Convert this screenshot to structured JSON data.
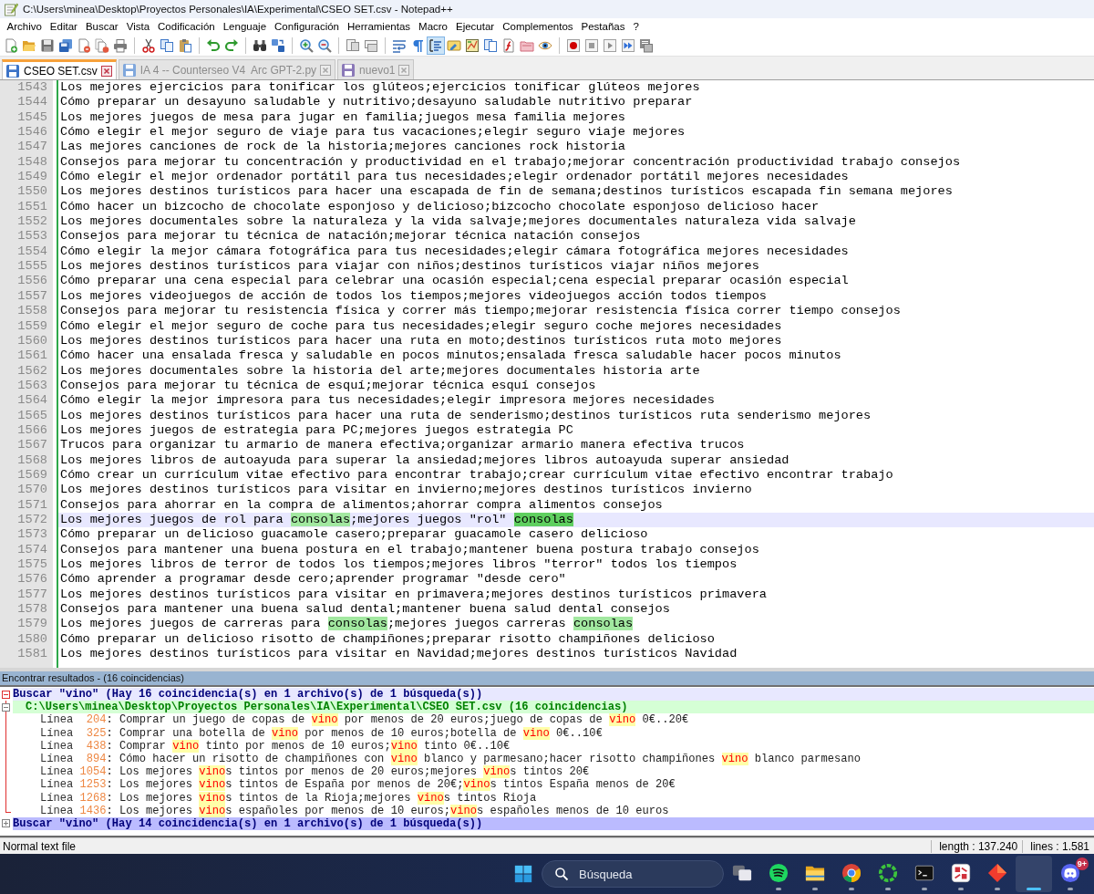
{
  "window": {
    "title": "C:\\Users\\minea\\Desktop\\Proyectos Personales\\IA\\Experimental\\CSEO SET.csv - Notepad++"
  },
  "menu": [
    "Archivo",
    "Editar",
    "Buscar",
    "Vista",
    "Codificación",
    "Lenguaje",
    "Configuración",
    "Herramientas",
    "Macro",
    "Ejecutar",
    "Complementos",
    "Pestañas",
    "?"
  ],
  "toolbar": [
    {
      "kind": "new",
      "pressed": false
    },
    {
      "kind": "open",
      "pressed": false
    },
    {
      "kind": "save",
      "pressed": false
    },
    {
      "kind": "save-all",
      "pressed": false
    },
    {
      "kind": "close",
      "pressed": false
    },
    {
      "kind": "close-all",
      "pressed": false
    },
    {
      "kind": "print",
      "pressed": false
    },
    {
      "kind": "separator"
    },
    {
      "kind": "cut",
      "pressed": false
    },
    {
      "kind": "copy",
      "pressed": false
    },
    {
      "kind": "paste",
      "pressed": false
    },
    {
      "kind": "separator"
    },
    {
      "kind": "undo",
      "pressed": false
    },
    {
      "kind": "redo",
      "pressed": false
    },
    {
      "kind": "separator"
    },
    {
      "kind": "find",
      "pressed": false
    },
    {
      "kind": "replace",
      "pressed": false
    },
    {
      "kind": "separator"
    },
    {
      "kind": "zoom-in",
      "pressed": false
    },
    {
      "kind": "zoom-out",
      "pressed": false
    },
    {
      "kind": "separator"
    },
    {
      "kind": "sync-vertical",
      "pressed": false
    },
    {
      "kind": "sync-horizontal",
      "pressed": false
    },
    {
      "kind": "separator"
    },
    {
      "kind": "wrap",
      "pressed": false
    },
    {
      "kind": "show-all",
      "pressed": false
    },
    {
      "kind": "indent-guide",
      "pressed": true
    },
    {
      "kind": "language",
      "pressed": false
    },
    {
      "kind": "doc-map",
      "pressed": false
    },
    {
      "kind": "doc-list",
      "pressed": false
    },
    {
      "kind": "function-list",
      "pressed": false
    },
    {
      "kind": "folder-workspace",
      "pressed": false
    },
    {
      "kind": "monitor",
      "pressed": false
    },
    {
      "kind": "separator"
    },
    {
      "kind": "record",
      "pressed": false
    },
    {
      "kind": "stop",
      "pressed": false
    },
    {
      "kind": "play",
      "pressed": false
    },
    {
      "kind": "play-multi",
      "pressed": false
    },
    {
      "kind": "save-macro",
      "pressed": false
    }
  ],
  "tabs": [
    {
      "label": "CSEO SET.csv",
      "selected": true,
      "color": "#3b73c7"
    },
    {
      "label": "IA 4 -- Counterseo V4  Arc GPT-2.py",
      "selected": false,
      "color": "#7fa7dc"
    },
    {
      "label": "nuevo1",
      "selected": false,
      "color": "#8a78b8"
    }
  ],
  "editor": {
    "lines": [
      {
        "number": "1543",
        "current": false,
        "text": "Los mejores ejercicios para tonificar los glúteos;ejercicios tonificar glúteos mejores"
      },
      {
        "number": "1544",
        "current": false,
        "text": "Cómo preparar un desayuno saludable y nutritivo;desayuno saludable nutritivo preparar"
      },
      {
        "number": "1545",
        "current": false,
        "text": "Los mejores juegos de mesa para jugar en familia;juegos mesa familia mejores"
      },
      {
        "number": "1546",
        "current": false,
        "text": "Cómo elegir el mejor seguro de viaje para tus vacaciones;elegir seguro viaje mejores"
      },
      {
        "number": "1547",
        "current": false,
        "text": "Las mejores canciones de rock de la historia;mejores canciones rock historia"
      },
      {
        "number": "1548",
        "current": false,
        "text": "Consejos para mejorar tu concentración y productividad en el trabajo;mejorar concentración productividad trabajo consejos"
      },
      {
        "number": "1549",
        "current": false,
        "text": "Cómo elegir el mejor ordenador portátil para tus necesidades;elegir ordenador portátil mejores necesidades"
      },
      {
        "number": "1550",
        "current": false,
        "text": "Los mejores destinos turísticos para hacer una escapada de fin de semana;destinos turísticos escapada fin semana mejores"
      },
      {
        "number": "1551",
        "current": false,
        "text": "Cómo hacer un bizcocho de chocolate esponjoso y delicioso;bizcocho chocolate esponjoso delicioso hacer"
      },
      {
        "number": "1552",
        "current": false,
        "text": "Los mejores documentales sobre la naturaleza y la vida salvaje;mejores documentales naturaleza vida salvaje"
      },
      {
        "number": "1553",
        "current": false,
        "text": "Consejos para mejorar tu técnica de natación;mejorar técnica natación consejos"
      },
      {
        "number": "1554",
        "current": false,
        "text": "Cómo elegir la mejor cámara fotográfica para tus necesidades;elegir cámara fotográfica mejores necesidades"
      },
      {
        "number": "1555",
        "current": false,
        "text": "Los mejores destinos turísticos para viajar con niños;destinos turísticos viajar niños mejores"
      },
      {
        "number": "1556",
        "current": false,
        "text": "Cómo preparar una cena especial para celebrar una ocasión especial;cena especial preparar ocasión especial"
      },
      {
        "number": "1557",
        "current": false,
        "text": "Los mejores videojuegos de acción de todos los tiempos;mejores videojuegos acción todos tiempos"
      },
      {
        "number": "1558",
        "current": false,
        "text": "Consejos para mejorar tu resistencia física y correr más tiempo;mejorar resistencia física correr tiempo consejos"
      },
      {
        "number": "1559",
        "current": false,
        "text": "Cómo elegir el mejor seguro de coche para tus necesidades;elegir seguro coche mejores necesidades"
      },
      {
        "number": "1560",
        "current": false,
        "text": "Los mejores destinos turísticos para hacer una ruta en moto;destinos turísticos ruta moto mejores"
      },
      {
        "number": "1561",
        "current": false,
        "text": "Cómo hacer una ensalada fresca y saludable en pocos minutos;ensalada fresca saludable hacer pocos minutos"
      },
      {
        "number": "1562",
        "current": false,
        "text": "Los mejores documentales sobre la historia del arte;mejores documentales historia arte"
      },
      {
        "number": "1563",
        "current": false,
        "text": "Consejos para mejorar tu técnica de esquí;mejorar técnica esquí consejos"
      },
      {
        "number": "1564",
        "current": false,
        "text": "Cómo elegir la mejor impresora para tus necesidades;elegir impresora mejores necesidades"
      },
      {
        "number": "1565",
        "current": false,
        "text": "Los mejores destinos turísticos para hacer una ruta de senderismo;destinos turísticos ruta senderismo mejores"
      },
      {
        "number": "1566",
        "current": false,
        "text": "Los mejores juegos de estrategia para PC;mejores juegos estrategia PC"
      },
      {
        "number": "1567",
        "current": false,
        "text": "Trucos para organizar tu armario de manera efectiva;organizar armario manera efectiva trucos"
      },
      {
        "number": "1568",
        "current": false,
        "text": "Los mejores libros de autoayuda para superar la ansiedad;mejores libros autoayuda superar ansiedad"
      },
      {
        "number": "1569",
        "current": false,
        "text": "Cómo crear un currículum vitae efectivo para encontrar trabajo;crear currículum vitae efectivo encontrar trabajo"
      },
      {
        "number": "1570",
        "current": false,
        "text": "Los mejores destinos turísticos para visitar en invierno;mejores destinos turísticos invierno"
      },
      {
        "number": "1571",
        "current": false,
        "text": "Consejos para ahorrar en la compra de alimentos;ahorrar compra alimentos consejos"
      },
      {
        "number": "1572",
        "current": true,
        "parts": [
          {
            "kind": "plain",
            "text": "Los mejores juegos de rol para "
          },
          {
            "kind": "smart",
            "text": "consolas"
          },
          {
            "kind": "plain",
            "text": ";mejores juegos \"rol\" "
          },
          {
            "kind": "selection",
            "text": "consolas"
          }
        ]
      },
      {
        "number": "1573",
        "current": false,
        "text": "Cómo preparar un delicioso guacamole casero;preparar guacamole casero delicioso"
      },
      {
        "number": "1574",
        "current": false,
        "text": "Consejos para mantener una buena postura en el trabajo;mantener buena postura trabajo consejos"
      },
      {
        "number": "1575",
        "current": false,
        "text": "Los mejores libros de terror de todos los tiempos;mejores libros \"terror\" todos los tiempos"
      },
      {
        "number": "1576",
        "current": false,
        "text": "Cómo aprender a programar desde cero;aprender programar \"desde cero\""
      },
      {
        "number": "1577",
        "current": false,
        "text": "Los mejores destinos turísticos para visitar en primavera;mejores destinos turísticos primavera"
      },
      {
        "number": "1578",
        "current": false,
        "text": "Consejos para mantener una buena salud dental;mantener buena salud dental consejos"
      },
      {
        "number": "1579",
        "current": false,
        "parts": [
          {
            "kind": "plain",
            "text": "Los mejores juegos de carreras para "
          },
          {
            "kind": "smart",
            "text": "consolas"
          },
          {
            "kind": "plain",
            "text": ";mejores juegos carreras "
          },
          {
            "kind": "smart",
            "text": "consolas"
          }
        ]
      },
      {
        "number": "1580",
        "current": false,
        "text": "Cómo preparar un delicioso risotto de champiñones;preparar risotto champiñones delicioso"
      },
      {
        "number": "1581",
        "current": false,
        "text": "Los mejores destinos turísticos para visitar en Navidad;mejores destinos turísticos Navidad"
      }
    ]
  },
  "find_results": {
    "title": "Encontrar resultados - (16 coincidencias)",
    "searches": [
      {
        "text": "Buscar \"vino\" (Hay 16 coincidencia(s) en 1 archivo(s) de 1 búsqueda(s))",
        "expanded": true,
        "current": true,
        "children": [
          {
            "path": "C:\\Users\\minea\\Desktop\\Proyectos Personales\\IA\\Experimental\\CSEO SET.csv (16 coincidencias)",
            "expanded": true,
            "children": [
              {
                "label": "Línea",
                "number": "204",
                "parts": [
                  {
                    "kind": "plain",
                    "text": ": Comprar un juego de copas de "
                  },
                  {
                    "kind": "match",
                    "text": "vino"
                  },
                  {
                    "kind": "plain",
                    "text": " por menos de 20 euros;juego de copas de "
                  },
                  {
                    "kind": "match",
                    "text": "vino"
                  },
                  {
                    "kind": "plain",
                    "text": " 0€..20€"
                  }
                ]
              },
              {
                "label": "Línea",
                "number": "325",
                "parts": [
                  {
                    "kind": "plain",
                    "text": ": Comprar una botella de "
                  },
                  {
                    "kind": "match",
                    "text": "vino"
                  },
                  {
                    "kind": "plain",
                    "text": " por menos de 10 euros;botella de "
                  },
                  {
                    "kind": "match",
                    "text": "vino"
                  },
                  {
                    "kind": "plain",
                    "text": " 0€..10€"
                  }
                ]
              },
              {
                "label": "Línea",
                "number": "438",
                "parts": [
                  {
                    "kind": "plain",
                    "text": ": Comprar "
                  },
                  {
                    "kind": "match",
                    "text": "vino"
                  },
                  {
                    "kind": "plain",
                    "text": " tinto por menos de 10 euros;"
                  },
                  {
                    "kind": "match",
                    "text": "vino"
                  },
                  {
                    "kind": "plain",
                    "text": " tinto 0€..10€"
                  }
                ]
              },
              {
                "label": "Línea",
                "number": "894",
                "parts": [
                  {
                    "kind": "plain",
                    "text": ": Cómo hacer un risotto de champiñones con "
                  },
                  {
                    "kind": "match",
                    "text": "vino"
                  },
                  {
                    "kind": "plain",
                    "text": " blanco y parmesano;hacer risotto champiñones "
                  },
                  {
                    "kind": "match",
                    "text": "vino"
                  },
                  {
                    "kind": "plain",
                    "text": " blanco parmesano"
                  }
                ]
              },
              {
                "label": "Línea",
                "number": "1054",
                "parts": [
                  {
                    "kind": "plain",
                    "text": ": Los mejores "
                  },
                  {
                    "kind": "match",
                    "text": "vino"
                  },
                  {
                    "kind": "plain",
                    "text": "s tintos por menos de 20 euros;mejores "
                  },
                  {
                    "kind": "match",
                    "text": "vino"
                  },
                  {
                    "kind": "plain",
                    "text": "s tintos 20€"
                  }
                ]
              },
              {
                "label": "Línea",
                "number": "1253",
                "parts": [
                  {
                    "kind": "plain",
                    "text": ": Los mejores "
                  },
                  {
                    "kind": "match",
                    "text": "vino"
                  },
                  {
                    "kind": "plain",
                    "text": "s tintos de España por menos de 20€;"
                  },
                  {
                    "kind": "match",
                    "text": "vino"
                  },
                  {
                    "kind": "plain",
                    "text": "s tintos España menos de 20€"
                  }
                ]
              },
              {
                "label": "Línea",
                "number": "1268",
                "parts": [
                  {
                    "kind": "plain",
                    "text": ": Los mejores "
                  },
                  {
                    "kind": "match",
                    "text": "vino"
                  },
                  {
                    "kind": "plain",
                    "text": "s tintos de la Rioja;mejores "
                  },
                  {
                    "kind": "match",
                    "text": "vino"
                  },
                  {
                    "kind": "plain",
                    "text": "s tintos Rioja"
                  }
                ]
              },
              {
                "label": "Línea",
                "number": "1436",
                "parts": [
                  {
                    "kind": "plain",
                    "text": ": Los mejores "
                  },
                  {
                    "kind": "match",
                    "text": "vino"
                  },
                  {
                    "kind": "plain",
                    "text": "s españoles por menos de 10 euros;"
                  },
                  {
                    "kind": "match",
                    "text": "vino"
                  },
                  {
                    "kind": "plain",
                    "text": "s españoles menos de 10 euros"
                  }
                ]
              }
            ]
          }
        ]
      },
      {
        "text": "Buscar \"vino\" (Hay 14 coincidencia(s) en 1 archivo(s) de 1 búsqueda(s))",
        "expanded": false,
        "current": false
      }
    ]
  },
  "status_bar": {
    "file_type": "Normal text file",
    "length": "length : 137.240",
    "lines": "lines : 1.581"
  },
  "taskbar": {
    "search": {
      "placeholder": "Búsqueda"
    },
    "apps": [
      {
        "kind": "task-view",
        "running": false,
        "active": false
      },
      {
        "kind": "music",
        "running": true,
        "active": false
      },
      {
        "kind": "files",
        "running": true,
        "active": false
      },
      {
        "kind": "browser",
        "running": true,
        "active": false
      },
      {
        "kind": "ring",
        "running": true,
        "active": false
      },
      {
        "kind": "terminal",
        "running": true,
        "active": false
      },
      {
        "kind": "tile",
        "running": true,
        "active": false
      },
      {
        "kind": "diamond",
        "running": true,
        "active": false
      },
      {
        "kind": "blank",
        "running": true,
        "active": true
      },
      {
        "kind": "chat",
        "running": true,
        "active": false,
        "badge": "9+"
      }
    ]
  }
}
